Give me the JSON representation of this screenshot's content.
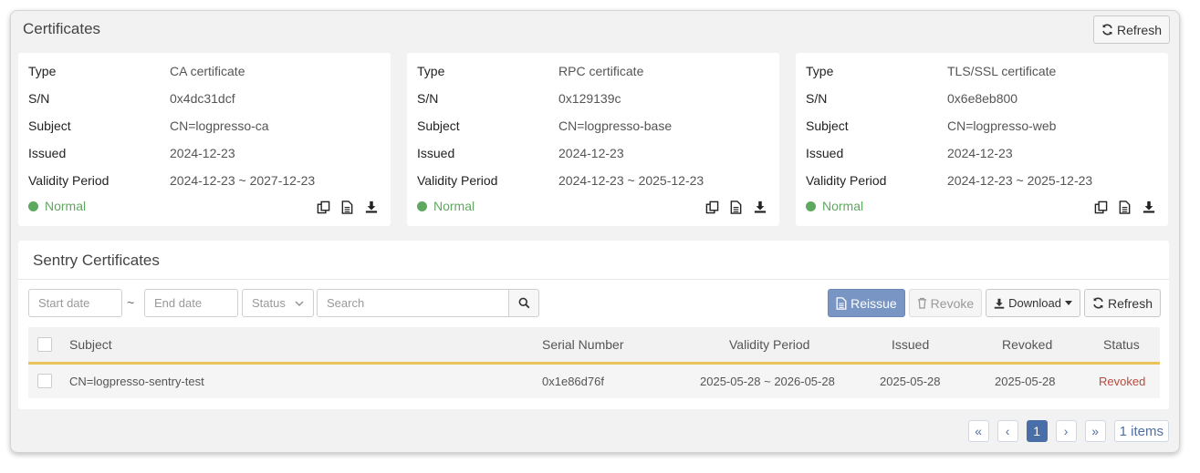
{
  "header": {
    "title": "Certificates",
    "refresh_label": "Refresh"
  },
  "labels": {
    "type": "Type",
    "sn": "S/N",
    "subject": "Subject",
    "issued": "Issued",
    "validity": "Validity Period"
  },
  "cards": [
    {
      "type": "CA certificate",
      "sn": "0x4dc31dcf",
      "subject": "CN=logpresso-ca",
      "issued": "2024-12-23",
      "validity": "2024-12-23 ~ 2027-12-23",
      "status": "Normal"
    },
    {
      "type": "RPC certificate",
      "sn": "0x129139c",
      "subject": "CN=logpresso-base",
      "issued": "2024-12-23",
      "validity": "2024-12-23 ~ 2025-12-23",
      "status": "Normal"
    },
    {
      "type": "TLS/SSL certificate",
      "sn": "0x6e8eb800",
      "subject": "CN=logpresso-web",
      "issued": "2024-12-23",
      "validity": "2024-12-23 ~ 2025-12-23",
      "status": "Normal"
    }
  ],
  "sentry": {
    "title": "Sentry Certificates",
    "filters": {
      "start_placeholder": "Start date",
      "tilde": "~",
      "end_placeholder": "End date",
      "status_label": "Status",
      "search_placeholder": "Search"
    },
    "buttons": {
      "reissue": "Reissue",
      "revoke": "Revoke",
      "download": "Download",
      "refresh": "Refresh"
    },
    "columns": [
      "Subject",
      "Serial Number",
      "Validity Period",
      "Issued",
      "Revoked",
      "Status"
    ],
    "rows": [
      {
        "subject": "CN=logpresso-sentry-test",
        "serial": "0x1e86d76f",
        "validity": "2025-05-28 ~ 2026-05-28",
        "issued": "2025-05-28",
        "revoked": "2025-05-28",
        "status": "Revoked"
      }
    ]
  },
  "pagination": {
    "first": "«",
    "prev": "‹",
    "current": "1",
    "next": "›",
    "last": "»",
    "count": "1 items"
  },
  "colors": {
    "normal": "#5fa85f",
    "revoked": "#b54b3f",
    "primary": "#7895c3",
    "accent": "#e8c357"
  }
}
